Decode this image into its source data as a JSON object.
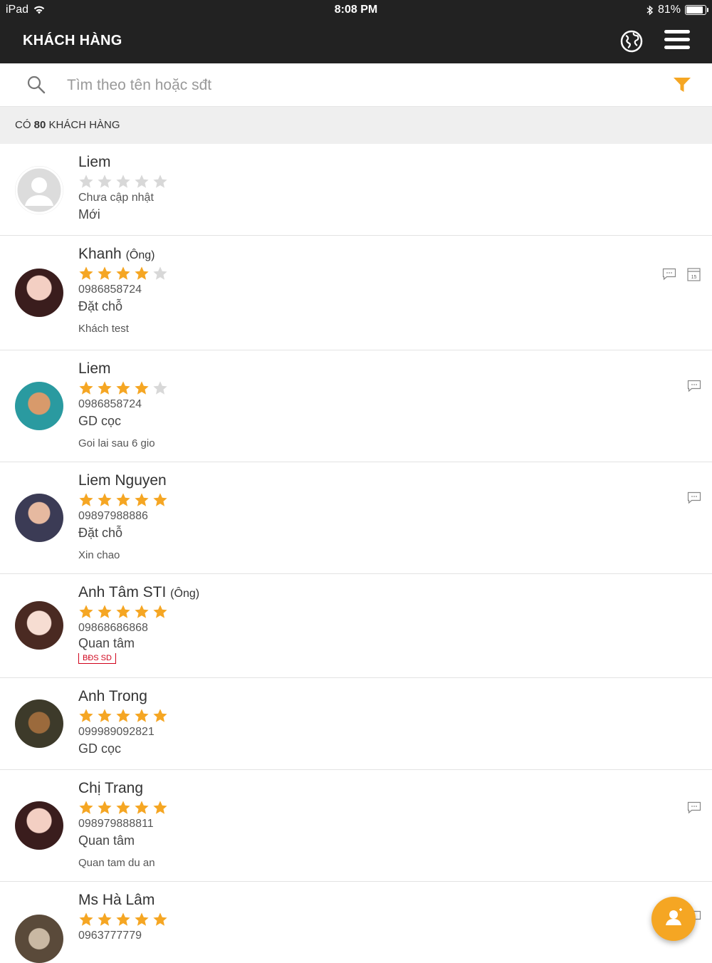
{
  "status_bar": {
    "device": "iPad",
    "time": "8:08 PM",
    "battery": "81%"
  },
  "header": {
    "title": "KHÁCH HÀNG"
  },
  "search": {
    "placeholder": "Tìm theo tên hoặc sđt"
  },
  "count": {
    "prefix": "CÓ ",
    "number": "80",
    "suffix": " KHÁCH HÀNG"
  },
  "colors": {
    "accent": "#F5A623",
    "star_off": "#D8D8D8",
    "header_bg": "#222222",
    "tag_red": "#D0021B"
  },
  "customers": [
    {
      "name": "Liem",
      "title": "",
      "rating": 0,
      "phone": "Chưa cập nhật",
      "status": "Mới",
      "note": "",
      "tag": "",
      "avatar": "default-avatar-icon",
      "icons": []
    },
    {
      "name": "Khanh",
      "title": "(Ông)",
      "rating": 4,
      "phone": "0986858724",
      "status": "Đặt chỗ",
      "note": "Khách test",
      "tag": "",
      "avatar": "avatar-photo",
      "icons": [
        "message-icon",
        "calendar-icon"
      ]
    },
    {
      "name": "Liem",
      "title": "",
      "rating": 4,
      "phone": "0986858724",
      "status": "GD cọc",
      "note": "Goi lai sau 6 gio",
      "tag": "",
      "avatar": "avatar-photo",
      "icons": [
        "message-icon"
      ]
    },
    {
      "name": "Liem Nguyen",
      "title": "",
      "rating": 5,
      "phone": "09897988886",
      "status": "Đặt chỗ",
      "note": "Xin chao",
      "tag": "",
      "avatar": "avatar-photo",
      "icons": [
        "message-icon"
      ]
    },
    {
      "name": "Anh Tâm STI",
      "title": "(Ông)",
      "rating": 5,
      "phone": "09868686868",
      "status": "Quan tâm",
      "note": "",
      "tag": "BĐS SD",
      "avatar": "avatar-photo",
      "icons": []
    },
    {
      "name": "Anh Trong",
      "title": "",
      "rating": 5,
      "phone": "099989092821",
      "status": "GD cọc",
      "note": "",
      "tag": "",
      "avatar": "avatar-photo",
      "icons": []
    },
    {
      "name": "Chị Trang",
      "title": "",
      "rating": 5,
      "phone": "098979888811",
      "status": "Quan tâm",
      "note": "Quan tam du an",
      "tag": "",
      "avatar": "avatar-photo",
      "icons": [
        "message-icon"
      ]
    },
    {
      "name": "Ms Hà Lâm",
      "title": "",
      "rating": 5,
      "phone": "0963777779",
      "status": "",
      "note": "",
      "tag": "",
      "avatar": "avatar-photo",
      "icons": [
        "message-icon"
      ]
    }
  ],
  "calendar_day": "15"
}
